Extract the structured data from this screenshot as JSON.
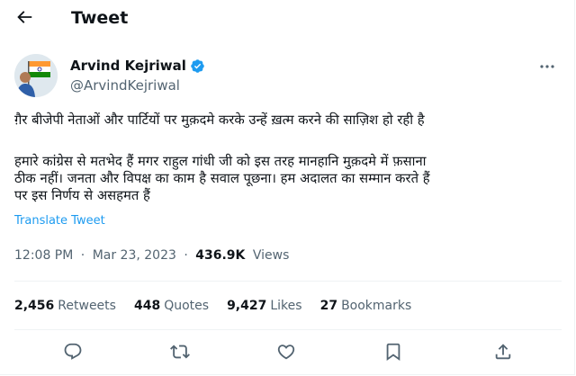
{
  "header": {
    "title": "Tweet",
    "back_icon": "back-arrow-icon"
  },
  "author": {
    "name": "Arvind Kejriwal",
    "handle": "@ArvindKejriwal",
    "verified": true,
    "avatar_icon": "avatar-image"
  },
  "tweet": {
    "lines": [
      "ग़ैर बीजेपी नेताओं और पार्टियों पर मुक़दमे करके उन्हें ख़त्म करने की साज़िश हो रही है",
      "हमारे कांग्रेस से मतभेद हैं मगर राहुल गांधी जी को इस तरह मानहानि मुक़दमे में फ़साना",
      "ठीक नहीं। जनता और विपक्ष का काम है सवाल पूछना। हम अदालत का सम्मान करते हैं",
      "पर इस निर्णय से असहमत हैं"
    ],
    "translate_label": "Translate Tweet"
  },
  "meta": {
    "time": "12:08 PM",
    "separator": "·",
    "date": "Mar 23, 2023",
    "views_count": "436.9K",
    "views_label": "Views"
  },
  "stats": [
    {
      "count": "2,456",
      "label": "Retweets"
    },
    {
      "count": "448",
      "label": "Quotes"
    },
    {
      "count": "9,427",
      "label": "Likes"
    },
    {
      "count": "27",
      "label": "Bookmarks"
    }
  ],
  "actions": [
    "reply-icon",
    "retweet-icon",
    "like-icon",
    "bookmark-icon",
    "share-icon"
  ],
  "colors": {
    "accent": "#1d9bf0",
    "text": "#0f1419",
    "secondary": "#536471",
    "divider": "#eff3f4"
  }
}
